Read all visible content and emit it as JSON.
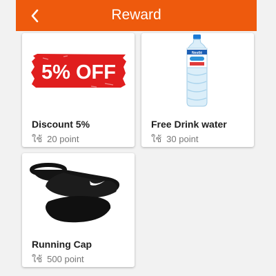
{
  "header": {
    "title": "Reward",
    "back_icon": "chevron-left-icon"
  },
  "colors": {
    "accent": "#ee5a0d",
    "badge_red": "#e01e1e"
  },
  "rewards": [
    {
      "name": "Discount 5%",
      "use_label": "ใช้",
      "points": "20 point",
      "image_text": "5% OFF"
    },
    {
      "name": "Free Drink water",
      "use_label": "ใช้",
      "points": "30 point",
      "image_text": "Nestlé"
    },
    {
      "name": "Running Cap",
      "use_label": "ใช้",
      "points": "500 point"
    }
  ]
}
